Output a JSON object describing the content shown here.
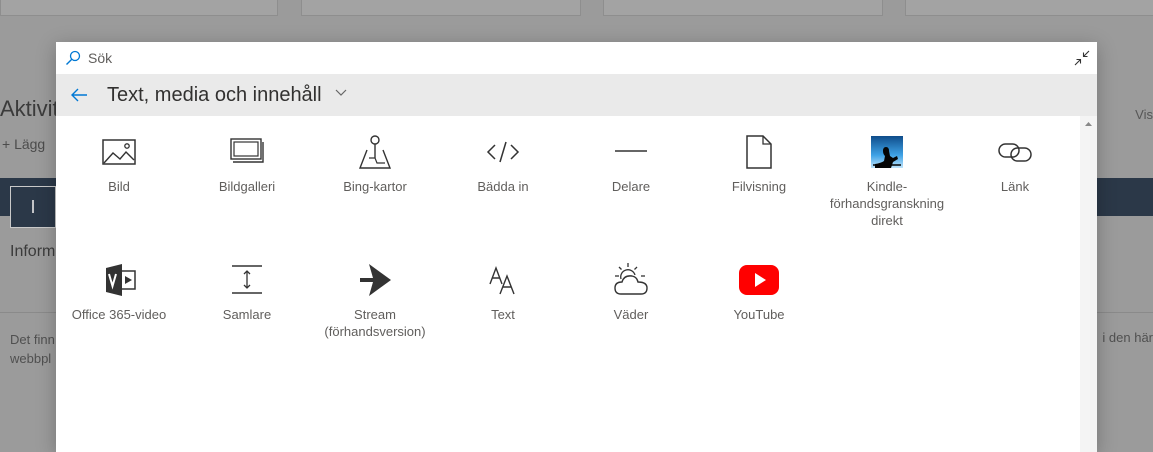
{
  "background": {
    "title": "Aktivit",
    "add": "+ Lägg",
    "box_letter": "I",
    "info": "Inform",
    "note": "Det finn webbpl",
    "vis": "Vis",
    "right_note": "i den här"
  },
  "search": {
    "placeholder": "Sök",
    "value": ""
  },
  "section": {
    "title": "Text, media och innehåll"
  },
  "tiles": [
    {
      "icon": "image-icon",
      "label": "Bild"
    },
    {
      "icon": "gallery-icon",
      "label": "Bildgalleri"
    },
    {
      "icon": "map-pin-icon",
      "label": "Bing-kartor"
    },
    {
      "icon": "code-icon",
      "label": "Bädda in"
    },
    {
      "icon": "divider-icon",
      "label": "Delare"
    },
    {
      "icon": "file-icon",
      "label": "Filvisning"
    },
    {
      "icon": "kindle-icon",
      "label": "Kindle-förhandsgranskning direkt"
    },
    {
      "icon": "link-icon",
      "label": "Länk"
    },
    {
      "icon": "office365-video-icon",
      "label": "Office 365-video"
    },
    {
      "icon": "spacer-icon",
      "label": "Samlare"
    },
    {
      "icon": "stream-icon",
      "label": "Stream (förhandsversion)"
    },
    {
      "icon": "text-icon",
      "label": "Text"
    },
    {
      "icon": "weather-icon",
      "label": "Väder"
    },
    {
      "icon": "youtube-icon",
      "label": "YouTube"
    }
  ],
  "colors": {
    "youtube_red": "#ff0000",
    "kindle_blue": "#1b7fc4",
    "header_bg": "#eaeaea"
  }
}
